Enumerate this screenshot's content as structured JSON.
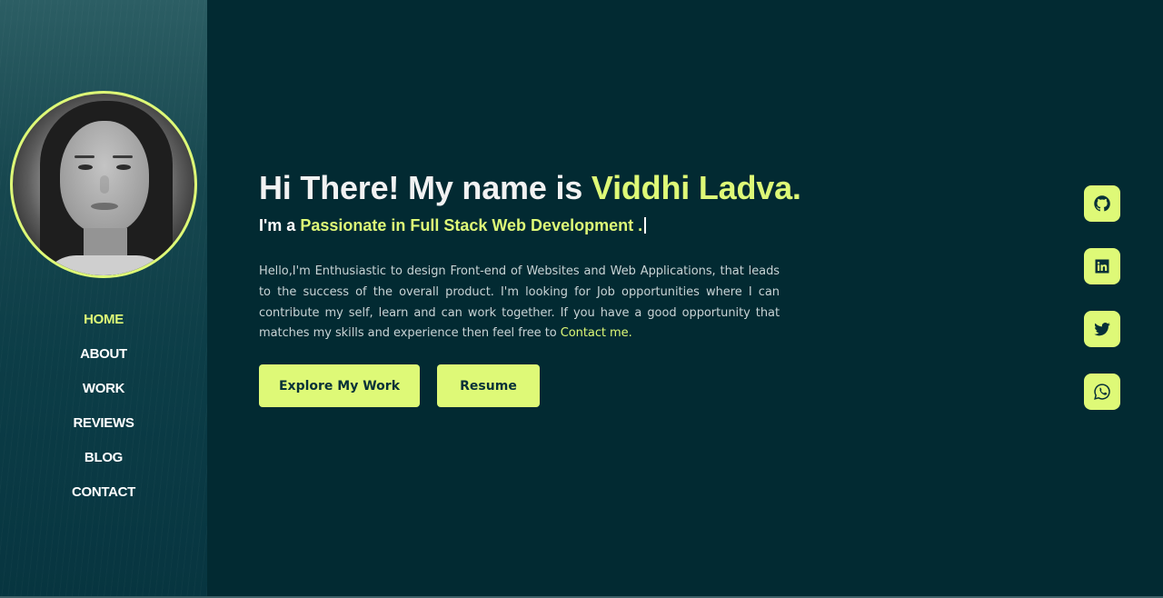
{
  "sidebar": {
    "avatar_alt": "Profile photo",
    "nav": [
      {
        "label": "HOME",
        "active": true
      },
      {
        "label": "ABOUT",
        "active": false
      },
      {
        "label": "WORK",
        "active": false
      },
      {
        "label": "REVIEWS",
        "active": false
      },
      {
        "label": "BLOG",
        "active": false
      },
      {
        "label": "CONTACT",
        "active": false
      }
    ]
  },
  "hero": {
    "greeting_prefix": "Hi There! My name is ",
    "name": "Viddhi Ladva.",
    "role_prefix": "I'm a ",
    "role": "Passionate in Full Stack Web Development .",
    "bio": "Hello,I'm Enthusiastic to design Front-end of Websites and Web Applications, that leads to the success of the overall product. I'm looking for Job opportunities where I can contribute my self, learn and can work together. If you have a good opportunity that matches my skills and experience then feel free to ",
    "contact_link": "Contact me.",
    "buttons": {
      "explore": "Explore My Work",
      "resume": "Resume"
    }
  },
  "socials": [
    {
      "icon": "github-icon"
    },
    {
      "icon": "linkedin-icon"
    },
    {
      "icon": "twitter-icon"
    },
    {
      "icon": "whatsapp-icon"
    }
  ],
  "colors": {
    "accent": "#def977",
    "background": "#022a32",
    "sidebar": "#0c3d47",
    "text": "#f2f2f2"
  }
}
